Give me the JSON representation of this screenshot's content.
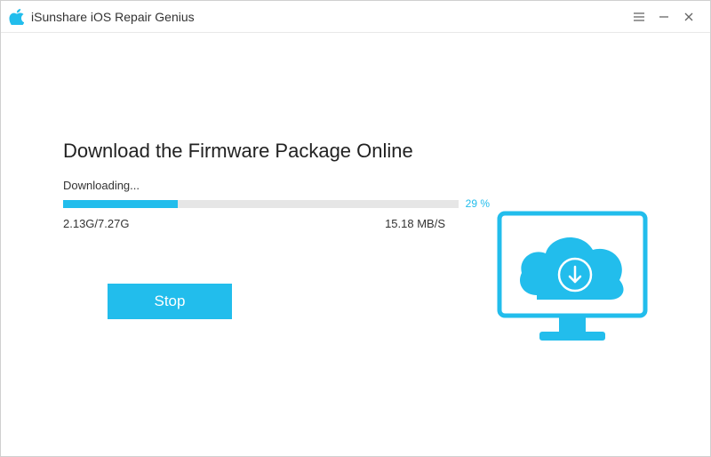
{
  "titlebar": {
    "title": "iSunshare iOS Repair Genius"
  },
  "main": {
    "heading": "Download the Firmware Package Online",
    "status": "Downloading...",
    "progress": {
      "percent": 29,
      "percent_label": "29 %",
      "downloaded_label": "2.13G/7.27G",
      "speed_label": "15.18 MB/S"
    },
    "stop_label": "Stop"
  },
  "colors": {
    "accent": "#22bdec"
  }
}
